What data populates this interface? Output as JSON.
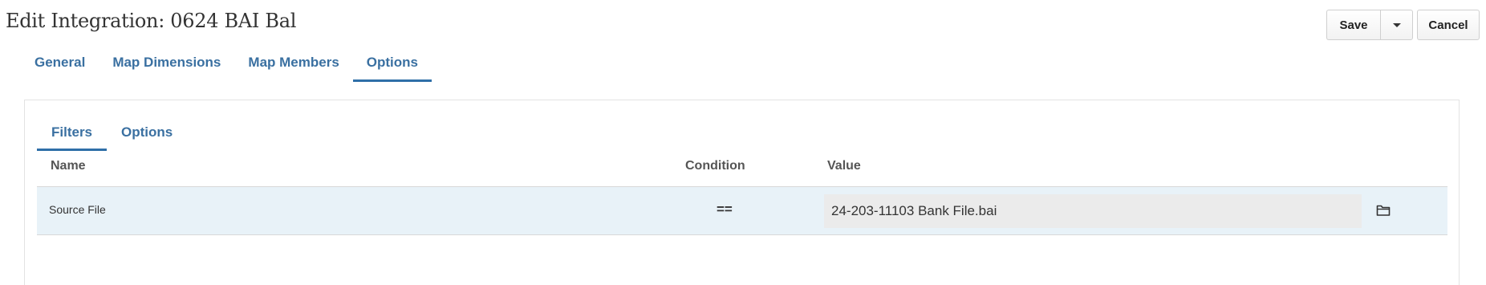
{
  "page": {
    "title": "Edit Integration: 0624 BAI Bal"
  },
  "actions": {
    "save_label": "Save",
    "cancel_label": "Cancel"
  },
  "main_tabs": [
    {
      "label": "General"
    },
    {
      "label": "Map Dimensions"
    },
    {
      "label": "Map Members"
    },
    {
      "label": "Options",
      "active": true
    }
  ],
  "sub_tabs": [
    {
      "label": "Filters",
      "active": true
    },
    {
      "label": "Options"
    }
  ],
  "grid": {
    "columns": {
      "name": "Name",
      "condition": "Condition",
      "value": "Value"
    },
    "rows": [
      {
        "name": "Source File",
        "condition": "==",
        "value": "24-203-11103 Bank File.bai"
      }
    ]
  },
  "icons": {
    "dropdown": "caret-down-icon",
    "browse": "folder-icon"
  },
  "colors": {
    "link_blue": "#3a70a1",
    "tab_underline": "#2f6fa8",
    "row_highlight": "#e8f2f8"
  }
}
